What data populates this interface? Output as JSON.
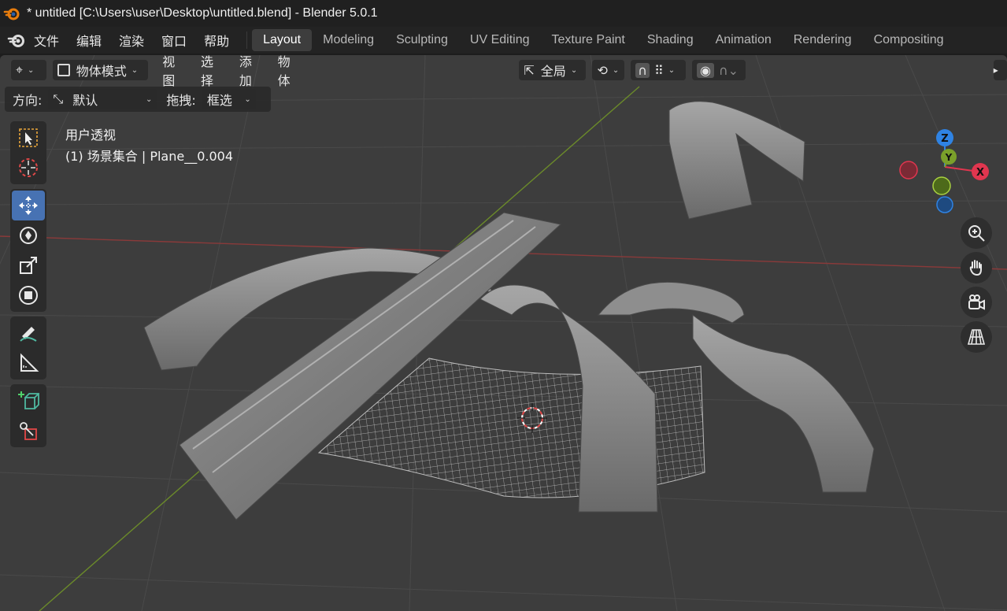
{
  "window": {
    "title": "* untitled [C:\\Users\\user\\Desktop\\untitled.blend] - Blender 5.0.1"
  },
  "menu": [
    "文件",
    "编辑",
    "渲染",
    "窗口",
    "帮助"
  ],
  "workspaces": [
    "Layout",
    "Modeling",
    "Sculpting",
    "UV Editing",
    "Texture Paint",
    "Shading",
    "Animation",
    "Rendering",
    "Compositing"
  ],
  "active_workspace": "Layout",
  "header": {
    "mode": "物体模式",
    "menus": [
      "视图",
      "选择",
      "添加",
      "物体"
    ],
    "transform_orientation": "全局"
  },
  "tool_settings": {
    "orientation_label": "方向:",
    "orientation_value": "默认",
    "drag_label": "拖拽:",
    "drag_value": "框选"
  },
  "viewport": {
    "view_name": "用户透视",
    "collection_info": "(1) 场景集合 | Plane__0.004"
  },
  "gizmo": {
    "z": "Z",
    "y": "Y",
    "x": "X"
  },
  "colors": {
    "accent": "#4772b3",
    "x_axis": "#e0364f",
    "y_axis": "#7aa02a",
    "z_axis": "#2f83e3",
    "grid_bg": "#3d3d3d"
  },
  "toolbar_icons": [
    "select-box-icon",
    "cursor-icon",
    "move-icon",
    "rotate-icon",
    "scale-icon",
    "transform-icon",
    "annotate-icon",
    "measure-icon",
    "add-cube-icon",
    "add-object-icon"
  ]
}
